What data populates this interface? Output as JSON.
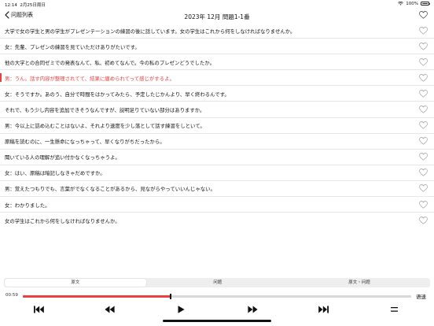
{
  "status_bar": {
    "time": "12:14",
    "date": "2月25日周日",
    "battery": "100%"
  },
  "nav": {
    "back_label": "问题列表",
    "title": "2023年 12月 問題1-1番"
  },
  "sentences": [
    {
      "text": "大学で女の学生と男の学生がプレゼンテーションの練習の後に話しています。女の学生はこれから何をしなければなりませんか。",
      "active": false
    },
    {
      "text": "女：先輩、プレゼンの練習を見ていただけありがたいです。",
      "active": false
    },
    {
      "text": "他の大学との合同ゼミでの発表なんて、私、初めてなんで。今の私のプレゼンどうでしたか。",
      "active": false
    },
    {
      "text": "男：うん。話す内容が整理されてて、結果に纏められてって感じがするよ。",
      "active": true
    },
    {
      "text": "女：そうですか。あのう、自分で時間をはかってみたら、予定したじかんより、早く終わるんです。",
      "active": false
    },
    {
      "text": "それで、もう少し内容を追加できそうなんですが、説明足りていない部分はありますか。",
      "active": false
    },
    {
      "text": "男：今以上に詰め込むことはないよ、それより速度を少し落として話す練習をしといて。",
      "active": false
    },
    {
      "text": "原稿を読むのに、一生懸命になっちゃって、早くなりがちだったから。",
      "active": false
    },
    {
      "text": "聞いている人の理解が追い付かなくなっちゃうよ。",
      "active": false
    },
    {
      "text": "女：はい、原稿は暗記しなきゃだめですか。",
      "active": false
    },
    {
      "text": "男：覚えたつもりでも、言葉がでなくなることがあるから、見ながらやっていいんじゃない。",
      "active": false
    },
    {
      "text": "女：わかりました。",
      "active": false
    },
    {
      "text": "女の学生はこれから何をしなければなりませんか。",
      "active": false
    }
  ],
  "tabs": [
    {
      "label": "原文",
      "selected": true
    },
    {
      "label": "问题",
      "selected": false
    },
    {
      "label": "原文・问题",
      "selected": false
    }
  ],
  "player": {
    "elapsed": "00:59",
    "progress": 0.38,
    "speed_label": "语速"
  },
  "icons": {
    "back": "chevron-left-icon",
    "favorite": "heart-outline-icon",
    "skip_start": "skip-to-start-icon",
    "rewind": "rewind-icon",
    "play": "play-icon",
    "fast_forward": "fast-forward-icon",
    "skip_end": "skip-to-end-icon",
    "menu": "menu-lines-icon"
  },
  "colors": {
    "accent": "#e9413f",
    "text": "#111111",
    "track": "#d8d8d8"
  }
}
